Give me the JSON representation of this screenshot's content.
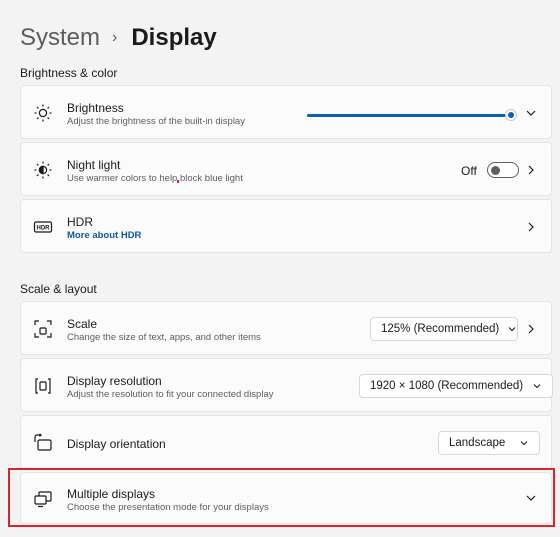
{
  "header": {
    "parent": "System",
    "separator": "›",
    "current": "Display"
  },
  "sections": {
    "brightness_color": "Brightness & color",
    "scale_layout": "Scale & layout"
  },
  "brightness": {
    "icon": "sun-icon",
    "title": "Brightness",
    "subtitle": "Adjust the brightness of the built-in display",
    "value_fraction": 0.97
  },
  "night_light": {
    "icon": "moon-sun-icon",
    "title": "Night light",
    "subtitle": "Use warmer colors to help block blue light",
    "toggle_label": "Off",
    "toggle_on": false
  },
  "hdr": {
    "icon": "hdr-icon",
    "title": "HDR",
    "link": "More about HDR"
  },
  "scale": {
    "icon": "scale-icon",
    "title": "Scale",
    "subtitle": "Change the size of text, apps, and other items",
    "value": "125% (Recommended)"
  },
  "resolution": {
    "icon": "resolution-icon",
    "title": "Display resolution",
    "subtitle": "Adjust the resolution to fit your connected display",
    "value": "1920 × 1080 (Recommended)"
  },
  "orientation": {
    "icon": "orientation-icon",
    "title": "Display orientation",
    "value": "Landscape"
  },
  "multiple_displays": {
    "icon": "multiple-displays-icon",
    "title": "Multiple displays",
    "subtitle": "Choose the presentation mode for your displays"
  },
  "colors": {
    "accent": "#0b5fb3",
    "highlight": "#d9232e",
    "link": "#0b5a9c"
  }
}
